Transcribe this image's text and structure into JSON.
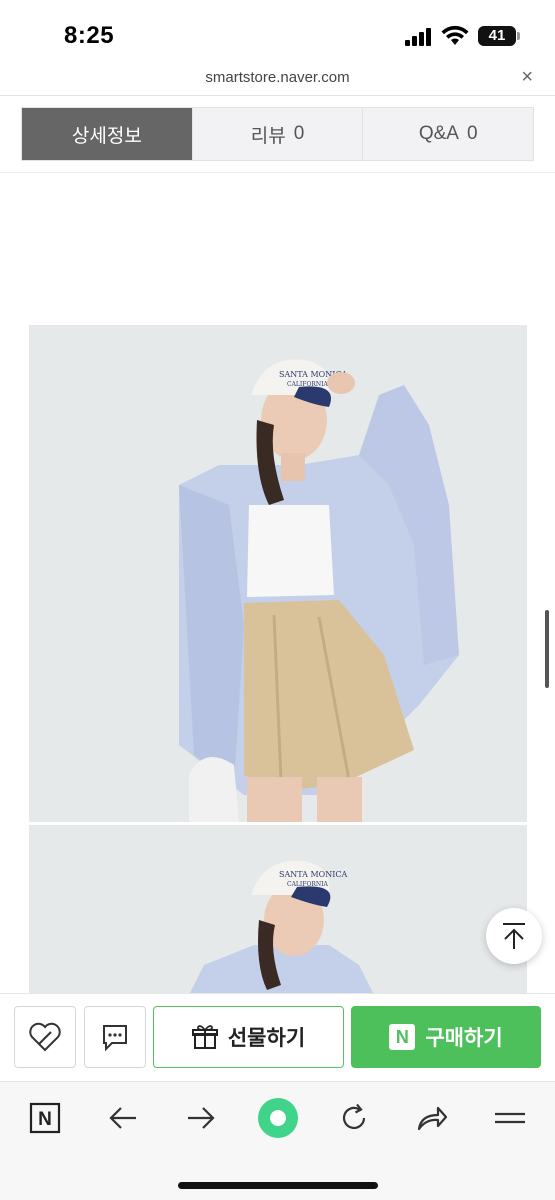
{
  "status": {
    "time": "8:25",
    "battery": "41"
  },
  "browser": {
    "url": "smartstore.naver.com",
    "close": "×"
  },
  "tabs": [
    {
      "label": "상세정보",
      "count": ""
    },
    {
      "label": "리뷰",
      "count": "0"
    },
    {
      "label": "Q&A",
      "count": "0"
    }
  ],
  "images": [
    {
      "alt_name": "product-photo-1"
    },
    {
      "alt_name": "product-photo-2"
    }
  ],
  "cap_text": {
    "line1": "SANTA MONICA",
    "line2": "CALIFORNIA"
  },
  "actions": {
    "gift_label": "선물하기",
    "buy_label": "구매하기",
    "buy_badge": "N"
  },
  "toolbar": {
    "icons": [
      "naver-home-icon",
      "back-arrow-icon",
      "forward-arrow-icon",
      "green-dot-icon",
      "refresh-icon",
      "share-icon",
      "menu-icon"
    ],
    "naver_badge": "N"
  },
  "colors": {
    "accent_green": "#4dc05b",
    "active_tab": "#666666"
  }
}
